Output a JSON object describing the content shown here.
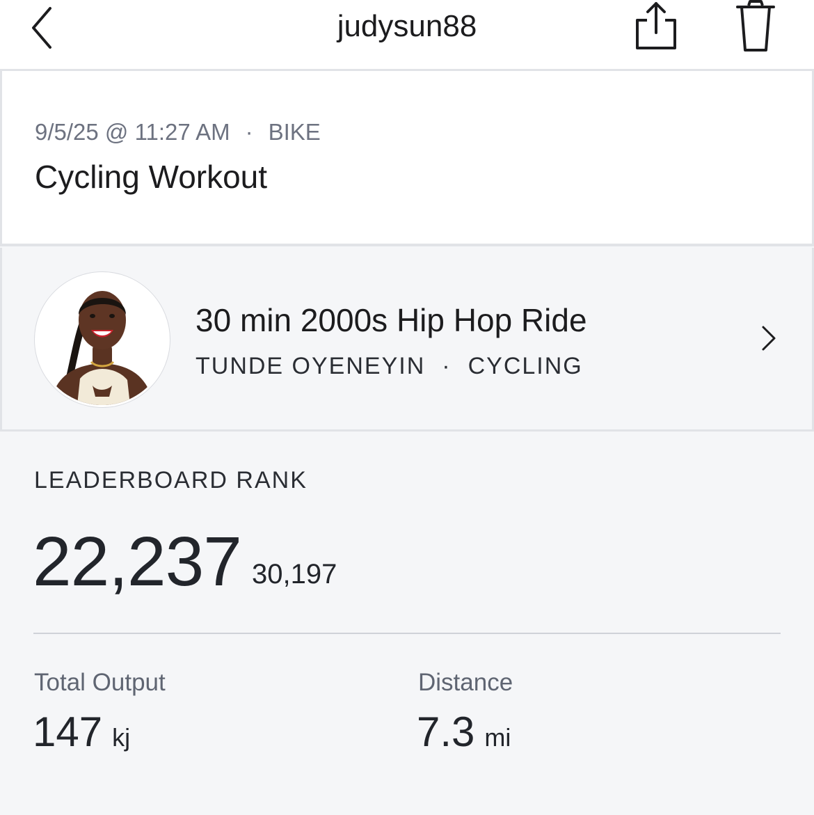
{
  "header": {
    "title": "judysun88",
    "back_icon": "chevron-left-icon",
    "share_icon": "share-icon",
    "delete_icon": "trash-icon"
  },
  "workout": {
    "datetime": "9/5/25 @ 11:27 AM",
    "separator": "·",
    "equipment": "BIKE",
    "title": "Cycling Workout"
  },
  "class_info": {
    "title": "30 min 2000s Hip Hop Ride",
    "instructor": "TUNDE OYENEYIN",
    "separator": "·",
    "discipline": "CYCLING",
    "chevron_icon": "chevron-right-icon"
  },
  "leaderboard": {
    "label": "LEADERBOARD RANK",
    "rank": "22,237",
    "total": "30,197"
  },
  "metrics": [
    {
      "label": "Total Output",
      "value": "147",
      "unit": "kj"
    },
    {
      "label": "Distance",
      "value": "7.3",
      "unit": "mi"
    }
  ],
  "colors": {
    "background": "#f5f6f8",
    "card": "#ffffff",
    "text_primary": "#1c1c1e",
    "text_secondary": "#6d7280",
    "border": "#e1e3e7"
  }
}
